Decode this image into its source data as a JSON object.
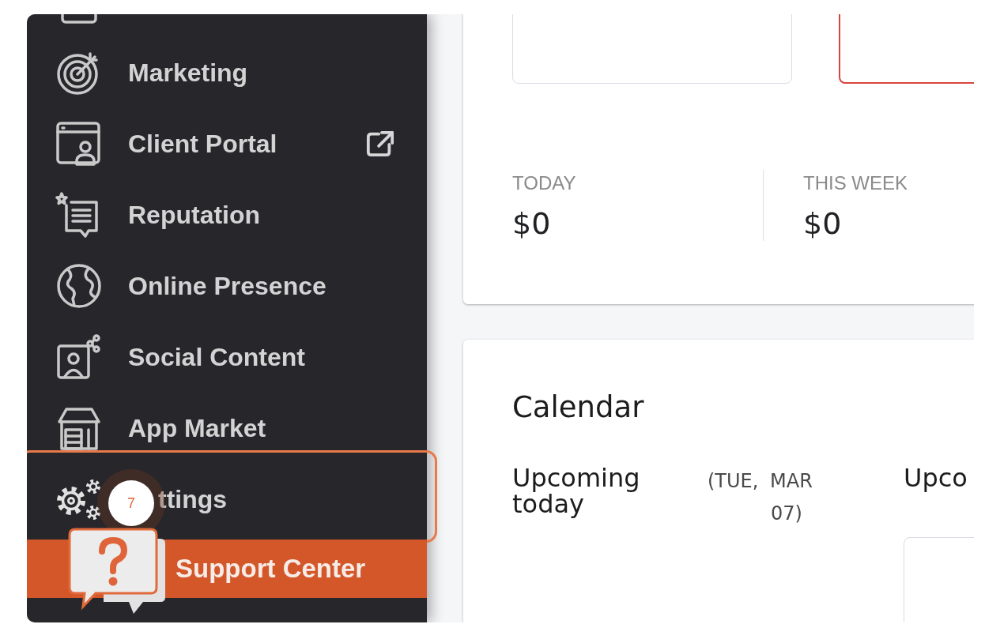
{
  "sidebar": {
    "items": [
      {
        "label": "Marketing",
        "external": false,
        "highlighted": false
      },
      {
        "label": "Client Portal",
        "external": true,
        "highlighted": false
      },
      {
        "label": "Reputation",
        "external": false,
        "highlighted": false
      },
      {
        "label": "Online Presence",
        "external": false,
        "highlighted": false
      },
      {
        "label": "Social Content",
        "external": false,
        "highlighted": false
      },
      {
        "label": "App Market",
        "external": false,
        "highlighted": false
      },
      {
        "label": "ttings",
        "external": false,
        "highlighted": true,
        "step": "7"
      }
    ],
    "support": {
      "label": "Support Center"
    }
  },
  "revenue": {
    "tiles": [
      {
        "selected": false
      },
      {
        "selected": true
      }
    ],
    "stats": [
      {
        "label": "TODAY",
        "value": "$0"
      },
      {
        "label": "THIS WEEK",
        "value": "$0"
      }
    ]
  },
  "calendar": {
    "title": "Calendar",
    "columns": [
      {
        "kind": "summary",
        "heading": "Upcoming today",
        "date": "(TUE, MAR 07)"
      },
      {
        "kind": "list",
        "heading": "Upco"
      }
    ]
  }
}
